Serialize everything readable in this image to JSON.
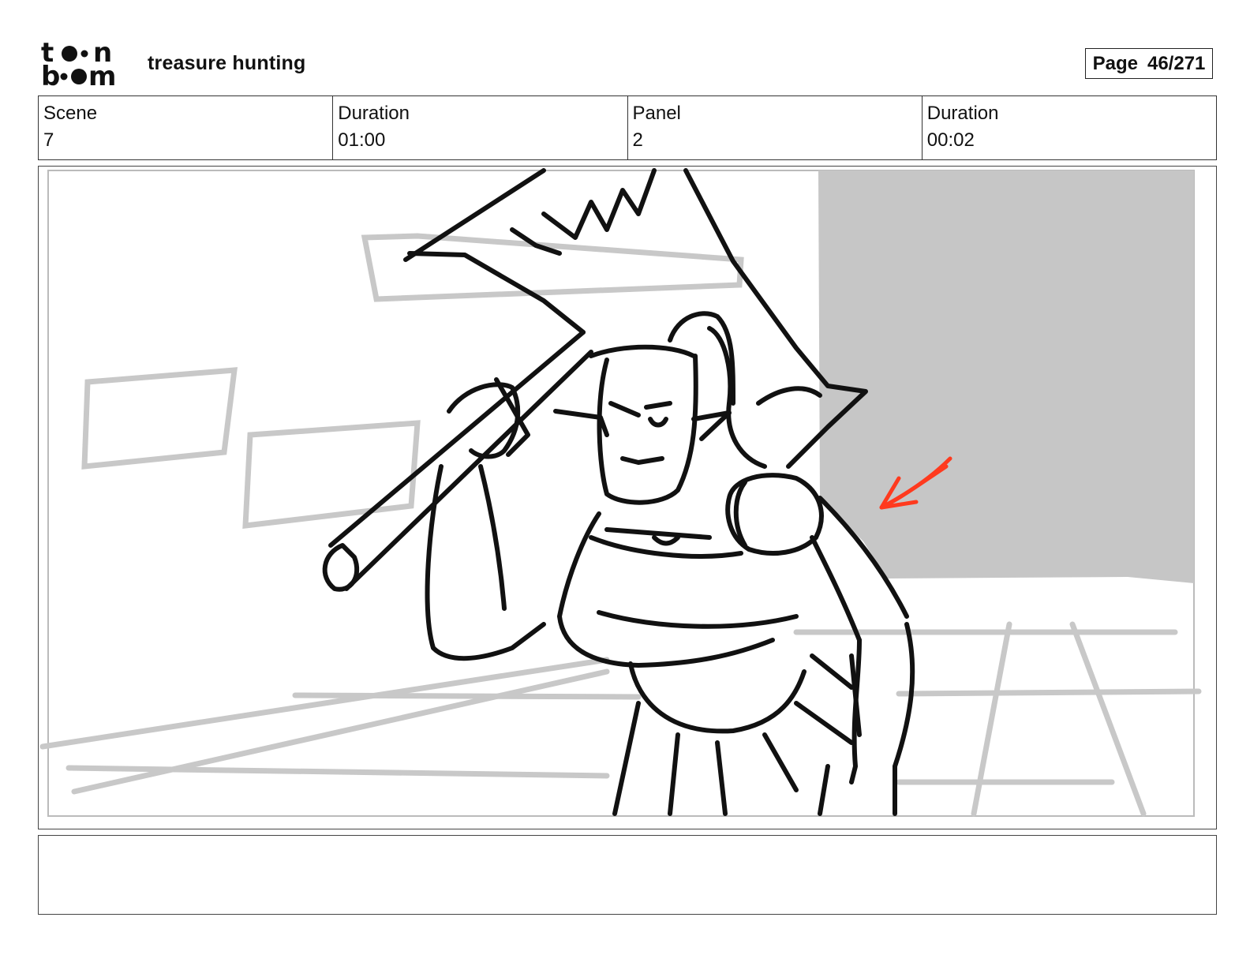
{
  "header": {
    "logo_text_top": "toon",
    "logo_text_bottom": "boom",
    "project_title": "treasure hunting",
    "page_label": "Page",
    "page_value": "46/271"
  },
  "info": [
    {
      "label": "Scene",
      "value": "7"
    },
    {
      "label": "Duration",
      "value": "01:00"
    },
    {
      "label": "Panel",
      "value": "2"
    },
    {
      "label": "Duration",
      "value": "00:02"
    }
  ],
  "colors": {
    "sketch_line": "#111111",
    "background_line": "#c8c8c8",
    "shadow_fill": "#c6c6c6",
    "annotation_arrow": "#ff3a1e"
  },
  "notes": ""
}
